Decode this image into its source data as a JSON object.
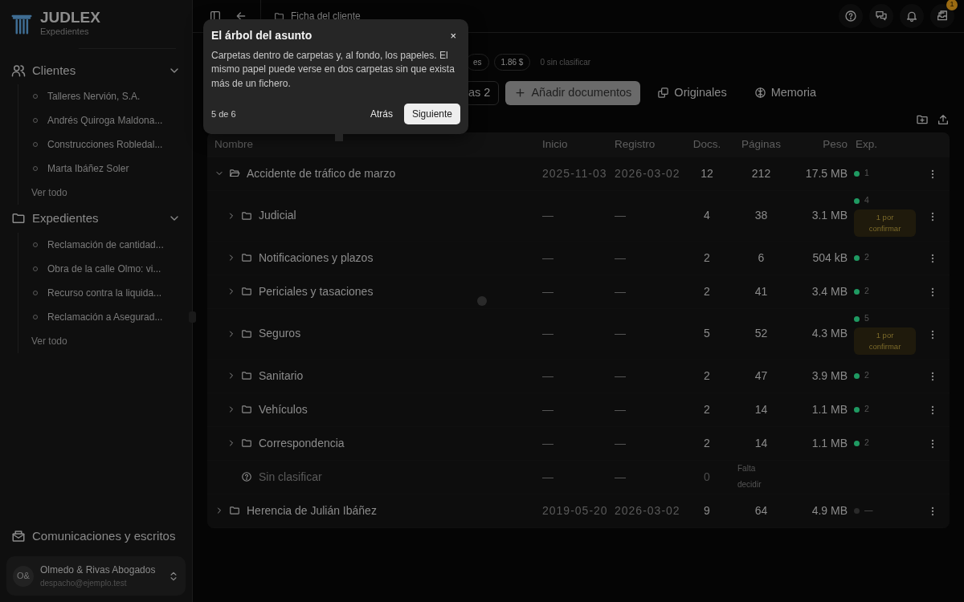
{
  "brand": {
    "name": "JUDLEX",
    "subtitle": "Expedientes"
  },
  "sidebar": {
    "sections": [
      {
        "label": "Clientes",
        "expanded": true,
        "items": [
          "Talleres Nervión, S.A.",
          "Andrés Quiroga Maldona...",
          "Construcciones Robledal...",
          "Marta Ibáñez Soler"
        ],
        "more": "Ver todo"
      },
      {
        "label": "Expedientes",
        "expanded": true,
        "items": [
          "Reclamación de cantidad...",
          "Obra de la calle Olmo: vi...",
          "Recurso contra la liquida...",
          "Reclamación a Asegurad..."
        ],
        "more": "Ver todo"
      }
    ],
    "footer_link": "Comunicaciones y escritos",
    "account": {
      "initials": "O&",
      "name": "Olmedo & Rivas Abogados",
      "email": "despacho@ejemplo.test"
    }
  },
  "breadcrumb": "Ficha del cliente",
  "notifications_badge": "1",
  "chips": [
    {
      "kind": "chip",
      "text": "es"
    },
    {
      "kind": "chip",
      "text": "1.86 $"
    },
    {
      "kind": "text",
      "text": "0 sin clasificar"
    }
  ],
  "actions": [
    {
      "kind": "outline",
      "label": "as 2"
    },
    {
      "kind": "primary",
      "label": "Añadir documentos"
    },
    {
      "kind": "link",
      "label": "Originales"
    },
    {
      "kind": "link",
      "label": "Memoria"
    }
  ],
  "table": {
    "columns": [
      "Nombre",
      "Inicio",
      "Registro",
      "Docs.",
      "Páginas",
      "Peso",
      "Exp."
    ],
    "rows": [
      {
        "kind": "folder",
        "name": "Accidente de tráfico de marzo",
        "expanded": true,
        "inicio": "2025-11-03",
        "registro": "2026-03-02",
        "docs": "12",
        "pages": "212",
        "size": "17.5 MB",
        "exp": "1",
        "color": "#1f9a62",
        "children": [
          {
            "kind": "folder",
            "name": "Judicial",
            "expanded": false,
            "inicio": "—",
            "registro": "—",
            "docs": "4",
            "pages": "38",
            "size": "3.1 MB",
            "exp": "4",
            "color": "#1f9a62",
            "pending": "1 por confirmar"
          },
          {
            "kind": "folder",
            "name": "Notificaciones y plazos",
            "expanded": false,
            "inicio": "—",
            "registro": "—",
            "docs": "2",
            "pages": "6",
            "size": "504 kB",
            "exp": "2",
            "color": "#1f9a62"
          },
          {
            "kind": "folder",
            "name": "Periciales y tasaciones",
            "expanded": false,
            "inicio": "—",
            "registro": "—",
            "docs": "2",
            "pages": "41",
            "size": "3.4 MB",
            "exp": "2",
            "color": "#1f9a62"
          },
          {
            "kind": "folder",
            "name": "Seguros",
            "expanded": false,
            "inicio": "—",
            "registro": "—",
            "docs": "5",
            "pages": "52",
            "size": "4.3 MB",
            "exp": "5",
            "color": "#1f9a62",
            "pending": "1 por confirmar"
          },
          {
            "kind": "folder",
            "name": "Sanitario",
            "expanded": false,
            "inicio": "—",
            "registro": "—",
            "docs": "2",
            "pages": "47",
            "size": "3.9 MB",
            "exp": "2",
            "color": "#1f9a62"
          },
          {
            "kind": "folder",
            "name": "Vehículos",
            "expanded": false,
            "inicio": "—",
            "registro": "—",
            "docs": "2",
            "pages": "14",
            "size": "1.1 MB",
            "exp": "2",
            "color": "#1f9a62"
          },
          {
            "kind": "folder",
            "name": "Correspondencia",
            "expanded": false,
            "inicio": "—",
            "registro": "—",
            "docs": "2",
            "pages": "14",
            "size": "1.1 MB",
            "exp": "2",
            "color": "#1f9a62"
          },
          {
            "kind": "unsorted",
            "name": "Sin clasificar",
            "inicio": "—",
            "registro": "—",
            "docs": "0",
            "pages": "Falta decidir"
          }
        ]
      },
      {
        "kind": "folder",
        "name": "Herencia de Julián Ibáñez",
        "expanded": false,
        "inicio": "2019-05-20",
        "registro": "2026-03-02",
        "docs": "9",
        "pages": "64",
        "size": "4.9 MB",
        "exp": "—",
        "color": "#2a2a2a"
      }
    ]
  },
  "tour": {
    "title": "El árbol del asunto",
    "body": "Carpetas dentro de carpetas y, al fondo, los papeles. El mismo papel puede verse en dos carpetas sin que exista más de un fichero.",
    "step": "5 de 6",
    "back": "Atrás",
    "next": "Siguiente",
    "close": "×"
  }
}
